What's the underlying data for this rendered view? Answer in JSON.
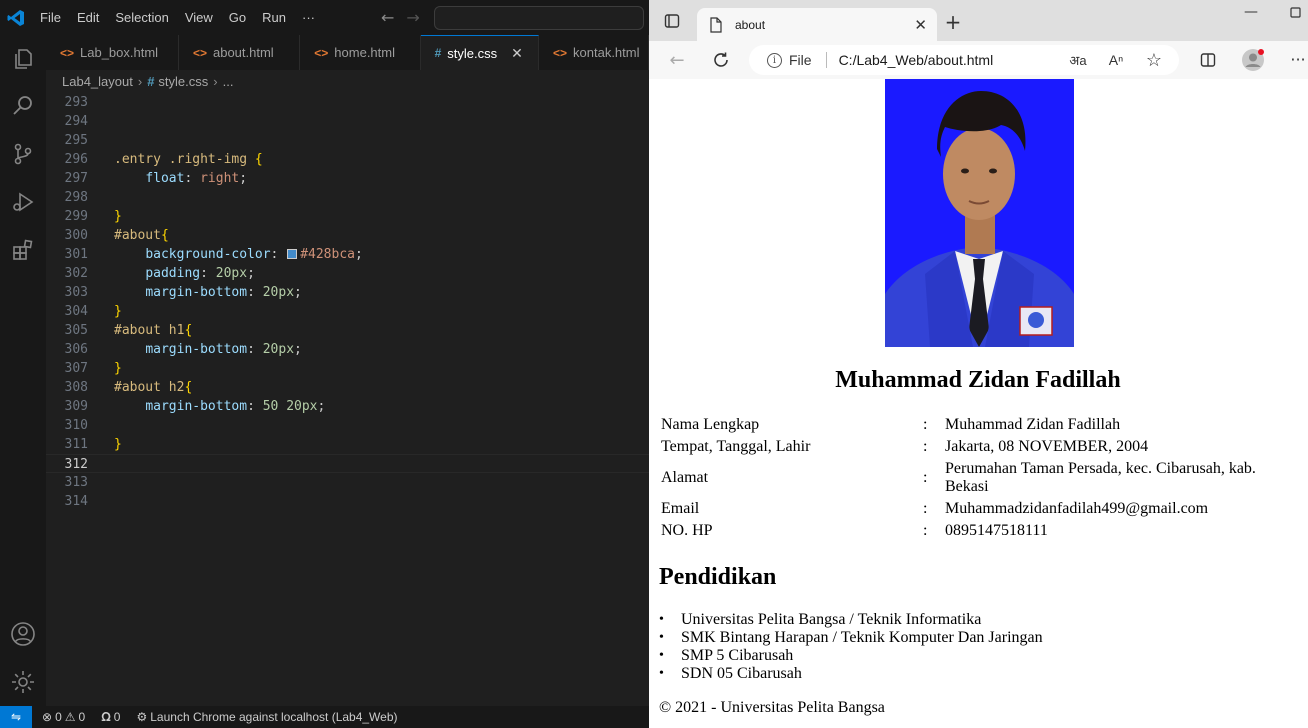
{
  "vscode": {
    "menu": [
      "File",
      "Edit",
      "Selection",
      "View",
      "Go",
      "Run"
    ],
    "menu_more": "···",
    "tabs": [
      {
        "label": "Lab_box.html",
        "type": "html"
      },
      {
        "label": "about.html",
        "type": "html"
      },
      {
        "label": "home.html",
        "type": "html"
      },
      {
        "label": "style.css",
        "type": "css"
      },
      {
        "label": "kontak.html",
        "type": "html"
      }
    ],
    "active_tab": "style.css",
    "breadcrumb": {
      "folder": "Lab4_layout",
      "file": "style.css",
      "more": "..."
    },
    "code_lines": [
      {
        "n": "293",
        "t": ""
      },
      {
        "n": "294",
        "t": ""
      },
      {
        "n": "295",
        "t": ""
      },
      {
        "n": "296",
        "t": ".entry .right-img {"
      },
      {
        "n": "297",
        "t": "    float: right;"
      },
      {
        "n": "298",
        "t": ""
      },
      {
        "n": "299",
        "t": "}"
      },
      {
        "n": "300",
        "t": "#about{"
      },
      {
        "n": "301",
        "t": "    background-color: #428bca;"
      },
      {
        "n": "302",
        "t": "    padding: 20px;"
      },
      {
        "n": "303",
        "t": "    margin-bottom: 20px;"
      },
      {
        "n": "304",
        "t": "}"
      },
      {
        "n": "305",
        "t": "#about h1{"
      },
      {
        "n": "306",
        "t": "    margin-bottom: 20px;"
      },
      {
        "n": "307",
        "t": "}"
      },
      {
        "n": "308",
        "t": "#about h2{"
      },
      {
        "n": "309",
        "t": "    margin-bottom: 50 20px;"
      },
      {
        "n": "310",
        "t": ""
      },
      {
        "n": "311",
        "t": "}"
      },
      {
        "n": "312",
        "t": ""
      },
      {
        "n": "313",
        "t": ""
      },
      {
        "n": "314",
        "t": ""
      }
    ],
    "current_line": "312",
    "swatch_color": "#428bca",
    "status": {
      "errors": "0",
      "warnings": "0",
      "ports": "0",
      "launch": "Launch Chrome against localhost (Lab4_Web)"
    },
    "accent": "#0078d4"
  },
  "browser": {
    "tab_title": "about",
    "address_scheme": "File",
    "address_path": "C:/Lab4_Web/about.html",
    "page": {
      "name": "Muhammad Zidan Fadillah",
      "bio": [
        {
          "label": "Nama Lengkap",
          "value": "Muhammad Zidan Fadillah"
        },
        {
          "label": "Tempat, Tanggal, Lahir",
          "value": "Jakarta, 08 NOVEMBER, 2004"
        },
        {
          "label": "Alamat",
          "value": "Perumahan Taman Persada, kec. Cibarusah, kab. Bekasi"
        },
        {
          "label": "Email",
          "value": "Muhammadzidanfadilah499@gmail.com"
        },
        {
          "label": "NO. HP",
          "value": "0895147518111"
        }
      ],
      "colon": ":",
      "education_heading": "Pendidikan",
      "education": [
        "Universitas Pelita Bangsa / Teknik Informatika",
        "SMK Bintang Harapan / Teknik Komputer Dan Jaringan",
        "SMP 5 Cibarusah",
        "SDN 05 Cibarusah"
      ],
      "footer": "© 2021 - Universitas Pelita Bangsa",
      "photo_background": "#1a1aff"
    }
  }
}
